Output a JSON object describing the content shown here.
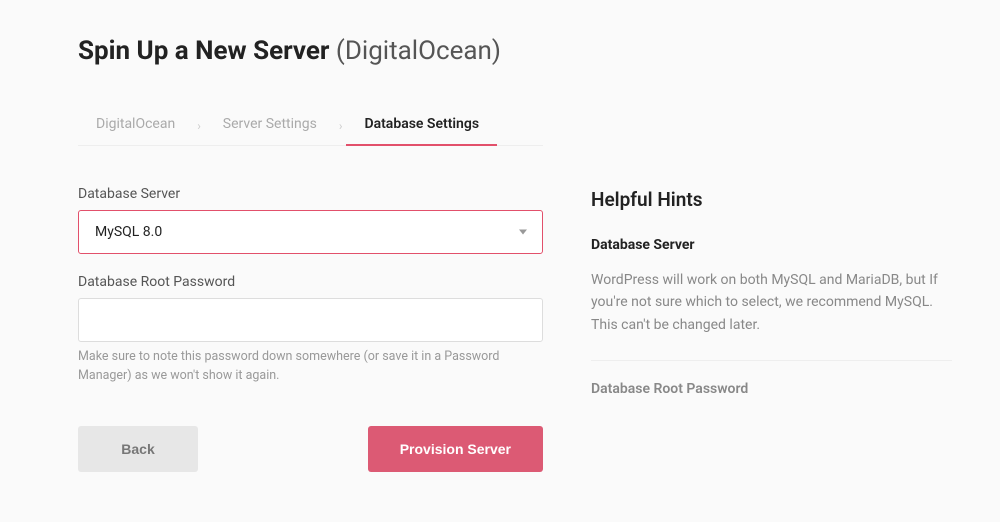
{
  "title": {
    "bold": "Spin Up a New Server",
    "light": " (DigitalOcean)"
  },
  "tabs": [
    {
      "label": "DigitalOcean",
      "active": false
    },
    {
      "label": "Server Settings",
      "active": false
    },
    {
      "label": "Database Settings",
      "active": true
    }
  ],
  "form": {
    "db_server_label": "Database Server",
    "db_server_value": "MySQL 8.0",
    "db_root_pw_label": "Database Root Password",
    "db_root_pw_value": "",
    "db_root_pw_hint": "Make sure to note this password down somewhere (or save it in a Password Manager) as we won't show it again."
  },
  "actions": {
    "back_label": "Back",
    "submit_label": "Provision Server"
  },
  "hints": {
    "title": "Helpful Hints",
    "db_server_heading": "Database Server",
    "db_server_text": "WordPress will work on both MySQL and MariaDB, but If you're not sure which to select, we recommend MySQL. This can't be changed later.",
    "db_root_pw_heading": "Database Root Password"
  }
}
